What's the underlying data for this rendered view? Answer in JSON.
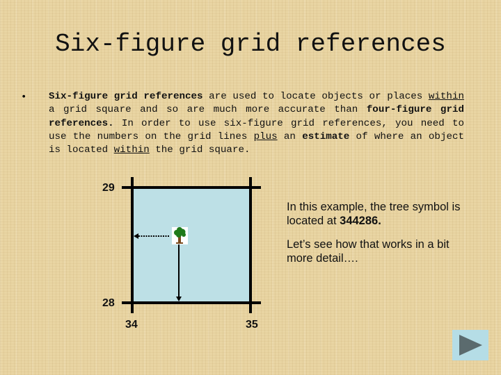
{
  "slide": {
    "title": "Six-figure grid references",
    "bullet_symbol": "•",
    "paragraph": {
      "t1_bold": "Six-figure grid references",
      "t2": " are used to locate objects or places ",
      "t3_underline": "within",
      "t4": " a grid square and so are much more accurate than ",
      "t5_bold": "four-figure grid references.",
      "t6": " In order to use six-figure grid references, you need to use the numbers on the grid lines ",
      "t7_underline": "plus",
      "t8": " an ",
      "t9_bold": "estimate",
      "t10": " of where an object is located ",
      "t11_underline": "within",
      "t12": " the grid square."
    }
  },
  "grid": {
    "northing_top": "29",
    "northing_bottom": "28",
    "easting_left": "34",
    "easting_right": "35",
    "square_color": "#bde0e6",
    "tree_symbol": "tree-icon",
    "tree_reference": "344286"
  },
  "caption": {
    "line1_prefix": "In this example, the tree symbol is located at ",
    "line1_value": "344286.",
    "line2": "Let’s see how that works in a bit more detail…."
  },
  "navigation": {
    "next_icon": "play-next-icon"
  }
}
